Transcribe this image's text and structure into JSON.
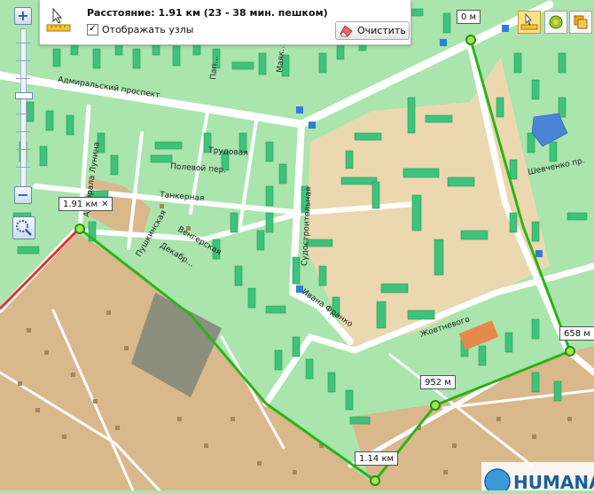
{
  "measure": {
    "label": "Расстояние:",
    "distance": "1.91 км (23 - 38 мин. пешком)",
    "show_nodes_label": "Отображать узлы",
    "show_nodes_checked": true,
    "clear_label": "Очистить"
  },
  "tools": [
    {
      "name": "ruler-tool",
      "active": true
    },
    {
      "name": "route-tool",
      "active": false
    },
    {
      "name": "layers-tool",
      "active": false
    }
  ],
  "route_labels": [
    {
      "id": "start",
      "text": "0 м"
    },
    {
      "id": "n658",
      "text": "658 м"
    },
    {
      "id": "n952",
      "text": "952 м"
    },
    {
      "id": "n1140",
      "text": "1.14 км"
    },
    {
      "id": "end",
      "text": "1.91 км",
      "closable": true
    }
  ],
  "streets": {
    "admiralsky": "Адмиральский проспект",
    "trudovaya": "Трудовая",
    "tankernaya": "Танкерная",
    "sudostroitelnaya": "Судостроительная",
    "admirala_lunina": "Адмирала Лунина",
    "ivana_franko": "Ивана Франко",
    "zhovtnevoe": "Жовтневого",
    "shevchenko": "Шевченко пр.",
    "papanina": "Пап...",
    "mayakovskogo": "Маяк...",
    "vengerskaya": "Венгерская",
    "pushkina": "Пушкинская",
    "dekabristov": "Декабр...",
    "polevoy": "Полевой пер."
  },
  "colors": {
    "route": "#2bb21a",
    "route_back": "#e03030",
    "land_green": "#a9e5ad",
    "building_green": "#3fc27a",
    "private_sector": "#d9b88c",
    "park_beige": "#ecd8b0",
    "road": "#ffffff"
  },
  "logo": {
    "text": "HUMANA"
  }
}
